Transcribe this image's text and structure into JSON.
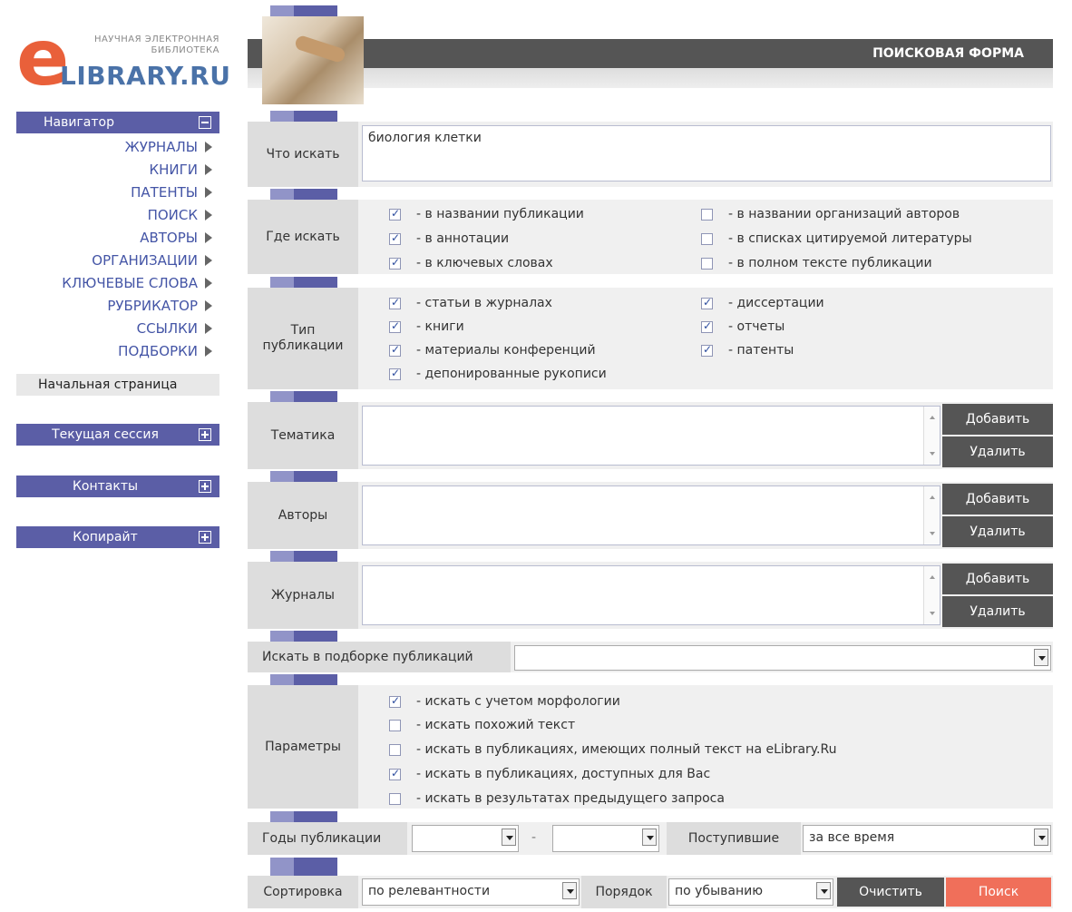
{
  "logo": {
    "line1": "НАУЧНАЯ ЭЛЕКТРОННАЯ",
    "line2": "БИБЛИОТЕКА",
    "letter": "e",
    "main": "LIBRARY.RU"
  },
  "sidebar": {
    "navigator_label": "Навигатор",
    "items": [
      {
        "label": "ЖУРНАЛЫ"
      },
      {
        "label": "КНИГИ"
      },
      {
        "label": "ПАТЕНТЫ"
      },
      {
        "label": "ПОИСК"
      },
      {
        "label": "АВТОРЫ"
      },
      {
        "label": "ОРГАНИЗАЦИИ"
      },
      {
        "label": "КЛЮЧЕВЫЕ СЛОВА"
      },
      {
        "label": "РУБРИКАТОР"
      },
      {
        "label": "ССЫЛКИ"
      },
      {
        "label": "ПОДБОРКИ"
      }
    ],
    "home_label": "Начальная страница",
    "session_label": "Текущая сессия",
    "contacts_label": "Контакты",
    "copyright_label": "Копирайт"
  },
  "header": {
    "title": "ПОИСКОВАЯ ФОРМА"
  },
  "form": {
    "what": {
      "label": "Что искать",
      "value": "биология клетки"
    },
    "where": {
      "label": "Где искать",
      "options": [
        {
          "label": "- в названии публикации",
          "checked": true
        },
        {
          "label": "- в аннотации",
          "checked": true
        },
        {
          "label": "- в ключевых словах",
          "checked": true
        },
        {
          "label": "- в названии организаций авторов",
          "checked": false
        },
        {
          "label": "- в списках цитируемой литературы",
          "checked": false
        },
        {
          "label": "- в полном тексте публикации",
          "checked": false
        }
      ]
    },
    "type": {
      "label_line1": "Тип",
      "label_line2": "публикации",
      "options": [
        {
          "label": "- статьи в журналах",
          "checked": true
        },
        {
          "label": "- книги",
          "checked": true
        },
        {
          "label": "- материалы конференций",
          "checked": true
        },
        {
          "label": "- депонированные рукописи",
          "checked": true
        },
        {
          "label": "- диссертации",
          "checked": true
        },
        {
          "label": "- отчеты",
          "checked": true
        },
        {
          "label": "- патенты",
          "checked": true
        }
      ]
    },
    "topic": {
      "label": "Тематика"
    },
    "authors": {
      "label": "Авторы"
    },
    "journals": {
      "label": "Журналы"
    },
    "add_label": "Добавить",
    "remove_label": "Удалить",
    "collection": {
      "label": "Искать в подборке публикаций",
      "value": ""
    },
    "params": {
      "label": "Параметры",
      "options": [
        {
          "label": "- искать с учетом морфологии",
          "checked": true
        },
        {
          "label": "- искать похожий текст",
          "checked": false
        },
        {
          "label": "- искать в публикациях, имеющих полный текст на eLibrary.Ru",
          "checked": false
        },
        {
          "label": "- искать в публикациях, доступных для Вас",
          "checked": true
        },
        {
          "label": "- искать в результатах предыдущего запроса",
          "checked": false
        }
      ]
    },
    "years": {
      "label": "Годы публикации",
      "from": "",
      "dash": "-",
      "to": ""
    },
    "received": {
      "label": "Поступившие",
      "value": "за все время"
    },
    "sort": {
      "label": "Сортировка",
      "value": "по релевантности"
    },
    "order": {
      "label": "Порядок",
      "value": "по убыванию"
    },
    "clear_label": "Очистить",
    "search_label": "Поиск"
  },
  "colors": {
    "accent": "#5b5ea6",
    "dark": "#555555",
    "search_button": "#f06f5a",
    "logo_e": "#e9603a",
    "logo_text": "#4a72a8"
  }
}
